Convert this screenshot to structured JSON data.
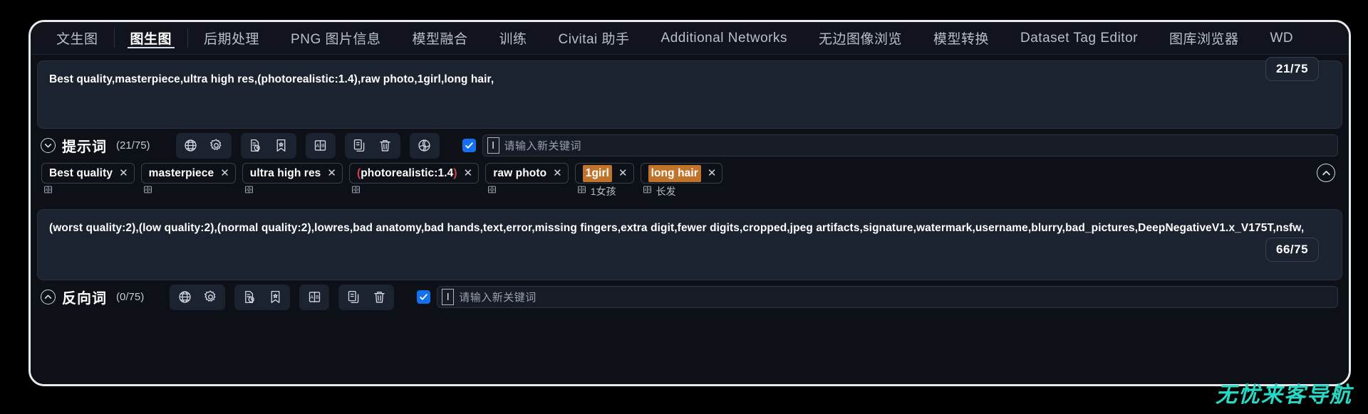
{
  "tabs": [
    {
      "label": "文生图",
      "active": false
    },
    {
      "label": "图生图",
      "active": true
    },
    {
      "label": "后期处理",
      "active": false
    },
    {
      "label": "PNG 图片信息",
      "active": false
    },
    {
      "label": "模型融合",
      "active": false
    },
    {
      "label": "训练",
      "active": false
    },
    {
      "label": "Civitai 助手",
      "active": false
    },
    {
      "label": "Additional Networks",
      "active": false
    },
    {
      "label": "无边图像浏览",
      "active": false
    },
    {
      "label": "模型转换",
      "active": false
    },
    {
      "label": "Dataset Tag Editor",
      "active": false
    },
    {
      "label": "图库浏览器",
      "active": false
    },
    {
      "label": "WD",
      "active": false
    }
  ],
  "positive": {
    "prompt_text": "Best quality,masterpiece,ultra high res,(photorealistic:1.4),raw photo,1girl,long hair,",
    "section_title": "提示词",
    "count": "(21/75)",
    "badge": "21/75",
    "chevron": "chevron-down",
    "keyword_placeholder": "请输入新关键词",
    "keyword_value": "",
    "icon_groups": [
      {
        "icons": [
          "globe-icon",
          "gear-icon"
        ]
      },
      {
        "icons": [
          "document-history-icon",
          "bookmark-icon"
        ]
      },
      {
        "icons": [
          "translate-ab-icon"
        ]
      },
      {
        "icons": [
          "copy-icon",
          "trash-icon"
        ]
      },
      {
        "icons": [
          "spiral-icon"
        ]
      }
    ],
    "tags": [
      {
        "text": "Best quality",
        "highlight": false,
        "paren": false,
        "translation": ""
      },
      {
        "text": "masterpiece",
        "highlight": false,
        "paren": false,
        "translation": ""
      },
      {
        "text": "ultra high res",
        "highlight": false,
        "paren": false,
        "translation": ""
      },
      {
        "text": "(photorealistic:1.4)",
        "highlight": false,
        "paren": true,
        "translation": ""
      },
      {
        "text": "raw photo",
        "highlight": false,
        "paren": false,
        "translation": ""
      },
      {
        "text": "1girl",
        "highlight": true,
        "paren": false,
        "translation": "1女孩"
      },
      {
        "text": "long hair",
        "highlight": true,
        "paren": false,
        "translation": "长发"
      }
    ]
  },
  "negative": {
    "prompt_text": "(worst quality:2),(low quality:2),(normal quality:2),lowres,bad anatomy,bad hands,text,error,missing fingers,extra digit,fewer digits,cropped,jpeg artifacts,signature,watermark,username,blurry,bad_pictures,DeepNegativeV1.x_V175T,nsfw,",
    "section_title": "反向词",
    "count": "(0/75)",
    "badge": "66/75",
    "chevron": "chevron-up",
    "keyword_placeholder": "请输入新关键词",
    "keyword_value": "",
    "icon_groups": [
      {
        "icons": [
          "globe-icon",
          "gear-icon"
        ]
      },
      {
        "icons": [
          "document-history-icon",
          "bookmark-icon"
        ]
      },
      {
        "icons": [
          "translate-ab-icon"
        ]
      },
      {
        "icons": [
          "copy-icon",
          "trash-icon"
        ]
      }
    ]
  },
  "collapse_all_icon": "chevron-up-circle",
  "watermark": "无忧来客导航",
  "colors": {
    "accent_blue": "#1570ef",
    "tag_highlight": "#c0732a",
    "paren_red": "#d1434b",
    "watermark": "#27d8c4",
    "panel_bg": "#0d1117",
    "box_bg": "#1b2230"
  }
}
